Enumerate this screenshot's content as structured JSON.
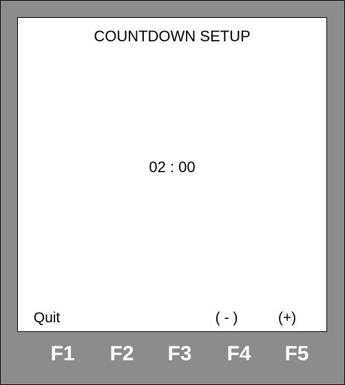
{
  "screen": {
    "title": "COUNTDOWN SETUP",
    "time_display": "02 : 00"
  },
  "softkeys": [
    {
      "key": "F1",
      "label": "Quit"
    },
    {
      "key": "F2",
      "label": ""
    },
    {
      "key": "F3",
      "label": ""
    },
    {
      "key": "F4",
      "label": "( - )"
    },
    {
      "key": "F5",
      "label": "(+)"
    }
  ],
  "colors": {
    "bezel": "#8c8c8c",
    "screen_background": "#ffffff",
    "function_key_text": "#ffffff"
  }
}
